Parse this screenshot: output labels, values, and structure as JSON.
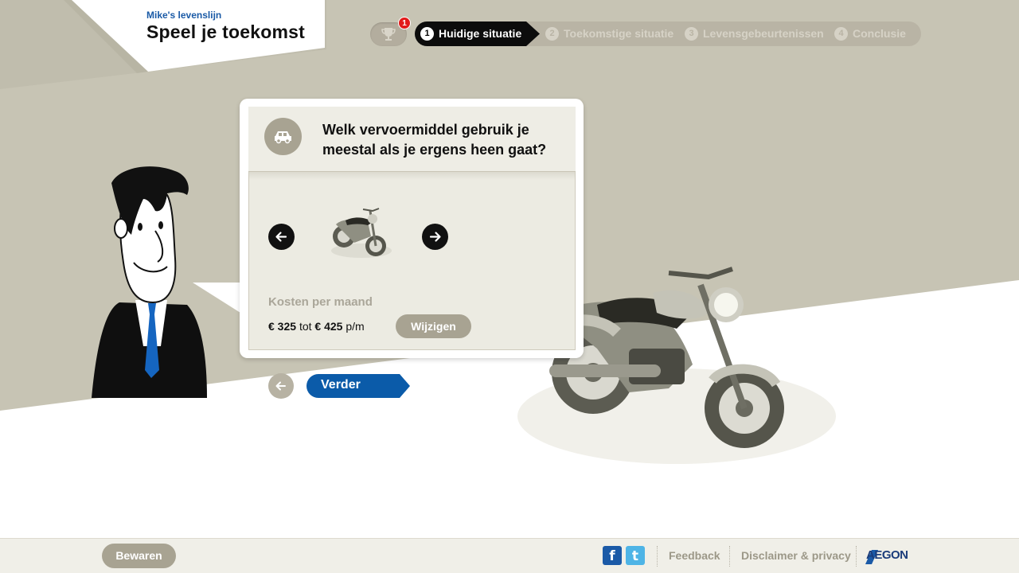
{
  "header": {
    "subtitle": "Mike's levenslijn",
    "title": "Speel je toekomst"
  },
  "trophy": {
    "badge_count": "1"
  },
  "steps": [
    {
      "num": "1",
      "label": "Huidige situatie",
      "active": true
    },
    {
      "num": "2",
      "label": "Toekomstige situatie",
      "active": false
    },
    {
      "num": "3",
      "label": "Levensgebeurtenissen",
      "active": false
    },
    {
      "num": "4",
      "label": "Conclusie",
      "active": false
    }
  ],
  "question": {
    "icon": "car-icon",
    "text": "Welk vervoermiddel gebruik je meestal als je ergens heen gaat?",
    "selected_option": "motorbike",
    "cost_label": "Kosten per maand",
    "cost_from": "€ 325",
    "cost_tot": "tot",
    "cost_to": "€ 425",
    "cost_unit": "p/m",
    "change_button": "Wijzigen"
  },
  "navigation": {
    "next_label": "Verder"
  },
  "footer": {
    "save_label": "Bewaren",
    "facebook": "f",
    "twitter": "t",
    "feedback": "Feedback",
    "disclaimer": "Disclaimer & privacy",
    "brand": "AEGON"
  },
  "colors": {
    "khaki": "#c6c3b3",
    "accent_blue": "#0b5ba9",
    "badge_red": "#e21a1a"
  }
}
